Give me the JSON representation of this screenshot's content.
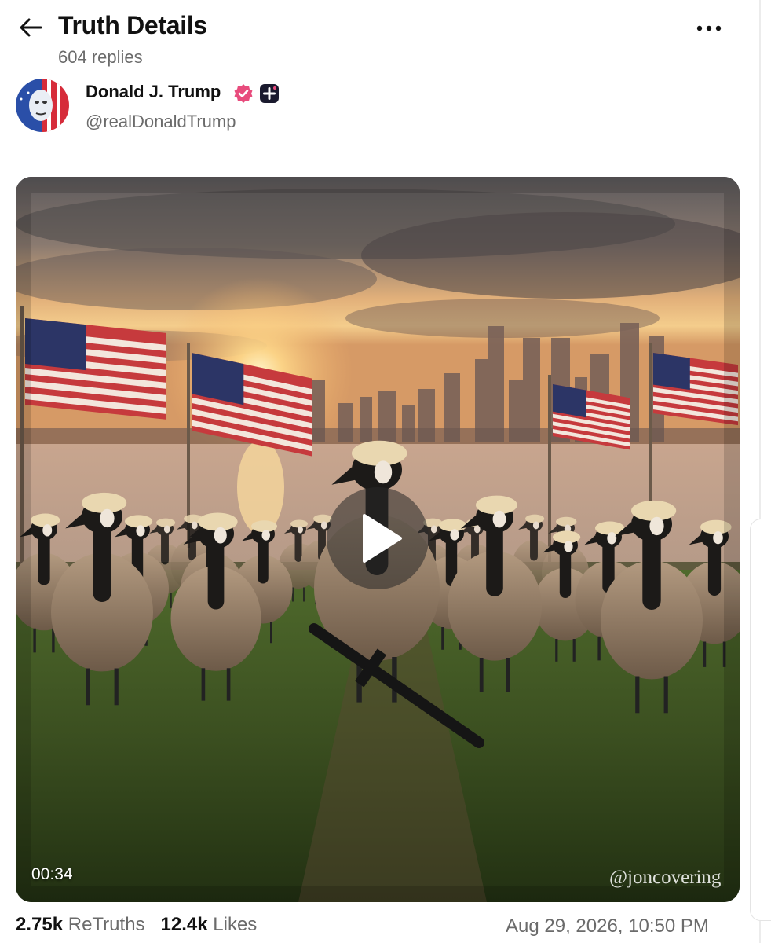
{
  "header": {
    "title": "Truth Details",
    "replies": "604 replies",
    "back_icon": "arrow-left-icon",
    "more_icon": "more-horizontal-icon"
  },
  "author": {
    "name": "Donald J. Trump",
    "handle": "@realDonaldTrump",
    "verified_icon": "verified-badge-icon",
    "plus_icon": "plus-badge-icon",
    "verified_color": "#e84c7d"
  },
  "media": {
    "type": "video",
    "duration": "00:34",
    "watermark": "@joncovering",
    "play_icon": "play-icon"
  },
  "stats": {
    "retruths_count": "2.75k",
    "retruths_label": "ReTruths",
    "likes_count": "12.4k",
    "likes_label": "Likes",
    "timestamp": "Aug 29, 2026, 10:50 PM"
  }
}
